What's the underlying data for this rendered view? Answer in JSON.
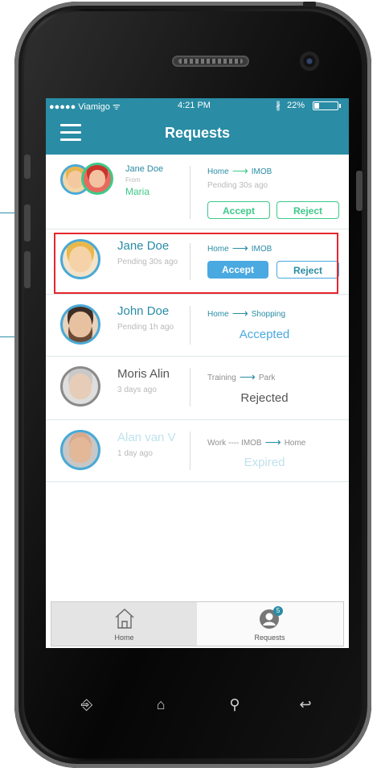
{
  "status_bar": {
    "carrier": "●●●●● Viamigo ᯤ",
    "time": "4:21 PM",
    "bluetooth": "∦",
    "battery": "22%"
  },
  "nav": {
    "title": "Requests",
    "menu_icon": "hamburger-menu-icon"
  },
  "requests": [
    {
      "name": "Jane Doe",
      "from_label": "From",
      "from_name": "Maria",
      "route_from": "Home",
      "route_to": "IMOB",
      "route_arrow": "⟶",
      "pending": "Pending 30s ago",
      "accept": "Accept",
      "reject": "Reject"
    },
    {
      "name": "Jane Doe",
      "pending": "Pending 30s ago",
      "route_from": "Home",
      "route_to": "IMOB",
      "route_arrow": "⟶",
      "accept": "Accept",
      "reject": "Reject"
    },
    {
      "name": "John Doe",
      "pending": "Pending 1h ago",
      "route_from": "Home",
      "route_to": "Shopping",
      "route_arrow": "⟶",
      "status": "Accepted"
    },
    {
      "name": "Moris Alin",
      "pending": "3 days ago",
      "route_from": "Training",
      "route_to": "Park",
      "route_arrow": "⟶",
      "status": "Rejected"
    },
    {
      "name": "Alan van V",
      "pending": "1 day ago",
      "route_from": "Work",
      "route_dash": "----",
      "route_mid": "IMOB",
      "route_to": "Home",
      "route_arrow": "⟶",
      "status": "Expired"
    }
  ],
  "tabs": {
    "home": "Home",
    "requests": "Requests",
    "requests_badge": "5"
  },
  "hardware_keys": [
    "⎆",
    "⌂",
    "⚲",
    "↩"
  ],
  "colors": {
    "primary": "#2a8ca5",
    "green": "#3ec98a",
    "blue": "#4aa9e0",
    "highlight": "#e5262c"
  }
}
